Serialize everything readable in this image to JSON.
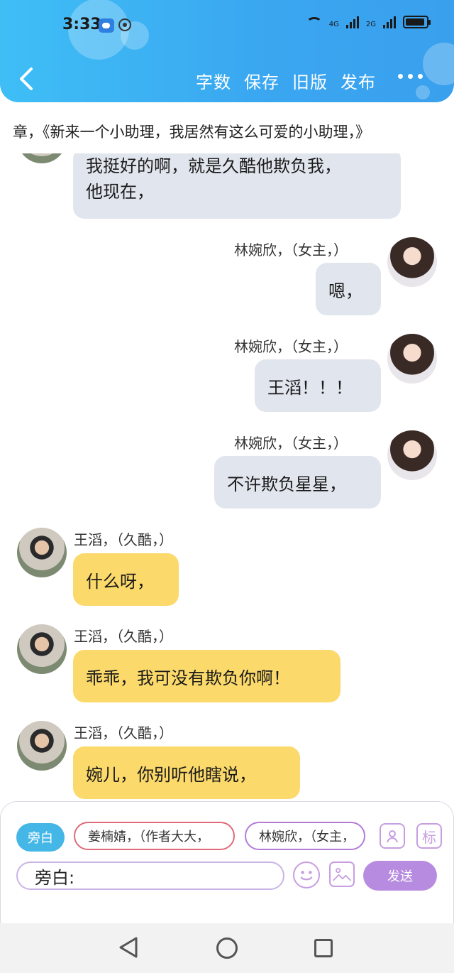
{
  "status_bar": {
    "time": "3:33",
    "network_1": "4G",
    "network_2": "2G"
  },
  "header": {
    "actions": [
      "字数",
      "保存",
      "旧版",
      "发布"
    ]
  },
  "chapter_title": "章，《新来一个小助理，我居然有这么可爱的小助理，》",
  "messages": [
    {
      "side": "left",
      "lines": [
        "我挺好的啊，就是久酷他欺负我，",
        "他现在，"
      ]
    },
    {
      "side": "right",
      "sender": "林婉欣，（女主，）",
      "text": "嗯，",
      "avatar": "female-avatar"
    },
    {
      "side": "right",
      "sender": "林婉欣，（女主，）",
      "text": "王滔！！！",
      "avatar": "female-avatar"
    },
    {
      "side": "right",
      "sender": "林婉欣，（女主，）",
      "text": "不许欺负星星，",
      "avatar": "female-avatar"
    },
    {
      "side": "left",
      "sender": "王滔，（久酷，）",
      "text": "什么呀，",
      "avatar": "male-avatar"
    },
    {
      "side": "left",
      "sender": "王滔，（久酷，）",
      "text": "乖乖，我可没有欺负你啊！",
      "avatar": "male-avatar"
    },
    {
      "side": "left",
      "sender": "王滔，（久酷，）",
      "text": "婉儿，你别听他瞎说，",
      "avatar": "male-avatar"
    }
  ],
  "panel": {
    "narration_chip": "旁白",
    "author_chip": "姜楠婧，（作者大大，",
    "heroine_chip": "林婉欣，（女主，",
    "role_icon": "person-card-icon",
    "mark_label": "标",
    "input_prefix": "旁白:",
    "input_value": "",
    "send_label": "发送"
  },
  "colors": {
    "header": "#3aa6f0",
    "bubble_self": "#e1e5ed",
    "bubble_other": "#fbd96b",
    "send": "#b78be0"
  }
}
